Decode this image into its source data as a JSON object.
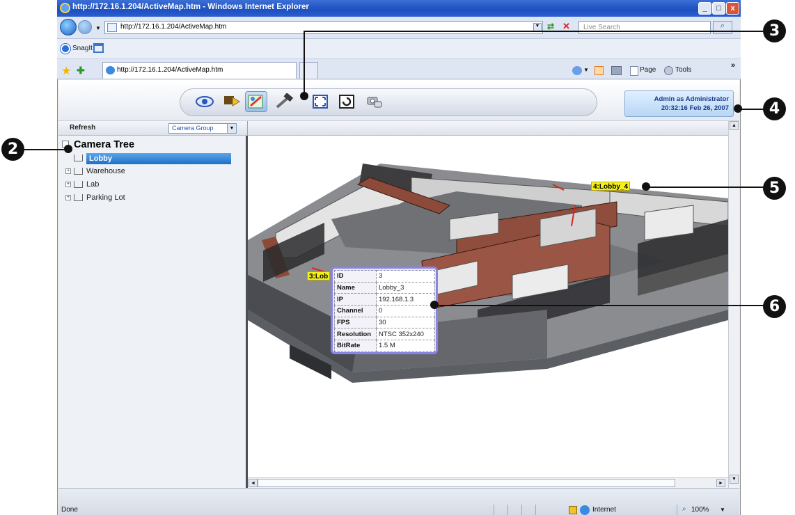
{
  "window": {
    "title": "http://172.16.1.204/ActiveMap.htm - Windows Internet Explorer",
    "controls": [
      "_",
      "□",
      "x"
    ]
  },
  "address_bar": {
    "url": "http://172.16.1.204/ActiveMap.htm",
    "search_placeholder": "Live Search"
  },
  "links_bar": {
    "snagit_label": "SnagIt"
  },
  "tabs": [
    {
      "label": "http://172.16.1.204/ActiveMap.htm"
    }
  ],
  "command_bar": {
    "page_label": "Page",
    "tools_label": "Tools"
  },
  "user_info": {
    "line1": "Admin as Administrator",
    "line2": "20:32:16 Feb 26, 2007"
  },
  "sidebar": {
    "refresh_label": "Refresh",
    "group_select_value": "Camera Group",
    "tree_title": "Camera Tree",
    "items": [
      {
        "label": "Lobby",
        "selected": true
      },
      {
        "label": "Warehouse",
        "selected": false
      },
      {
        "label": "Lab",
        "selected": false
      },
      {
        "label": "Parking Lot",
        "selected": false
      }
    ]
  },
  "camera_tags": [
    {
      "label": "4:Lobby_4"
    },
    {
      "label": "3:Lob"
    }
  ],
  "camera_info": {
    "rows": [
      {
        "key": "ID",
        "value": "3"
      },
      {
        "key": "Name",
        "value": "Lobby_3"
      },
      {
        "key": "IP",
        "value": "192.168.1.3"
      },
      {
        "key": "Channel",
        "value": "0"
      },
      {
        "key": "FPS",
        "value": "30"
      },
      {
        "key": "Resolution",
        "value": "NTSC 352x240"
      },
      {
        "key": "BitRate",
        "value": "1.5 M"
      }
    ]
  },
  "status_bar": {
    "status_text": "Done",
    "zone_label": "Internet",
    "zoom_label": "100%"
  },
  "callouts": [
    "2",
    "3",
    "4",
    "5",
    "6"
  ],
  "icons": [
    "eye-icon",
    "camera-icon",
    "map-edit-icon",
    "hammer-icon",
    "fullscreen-icon",
    "refresh-view-icon",
    "camera-group-icon"
  ]
}
